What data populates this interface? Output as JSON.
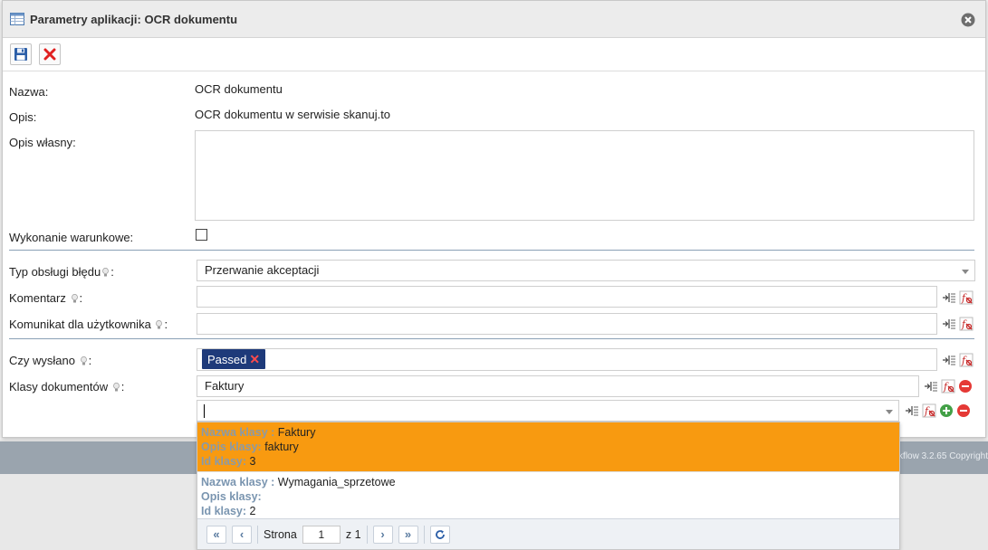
{
  "dialog": {
    "title": "Parametry aplikacji: OCR dokumentu"
  },
  "background": {
    "footer_text": "kflow 3.2.65 Copyright"
  },
  "form": {
    "name_label": "Nazwa:",
    "name_value": "OCR dokumentu",
    "desc_label": "Opis:",
    "desc_value": "OCR dokumentu w serwisie skanuj.to",
    "own_desc_label": "Opis własny:",
    "own_desc_value": "",
    "conditional_label": "Wykonanie warunkowe:",
    "conditional_checked": false,
    "error_type_label": "Typ obsługi błędu",
    "error_type_value": "Przerwanie akceptacji",
    "comment_label": "Komentarz",
    "comment_value": "",
    "user_message_label": "Komunikat dla użytkownika",
    "user_message_value": "",
    "sent_label": "Czy wysłano",
    "sent_tag": "Passed",
    "doc_classes_label": "Klasy dokumentów",
    "doc_classes_value": "Faktury",
    "colon": ":"
  },
  "dropdown": {
    "options": [
      {
        "name_key": "Nazwa klasy :",
        "name": "Faktury",
        "desc_key": "Opis klasy:",
        "desc": "faktury",
        "id_key": "Id klasy:",
        "id": "3",
        "selected": true
      },
      {
        "name_key": "Nazwa klasy :",
        "name": "Wymagania_sprzetowe",
        "desc_key": "Opis klasy:",
        "desc": "",
        "id_key": "Id klasy:",
        "id": "2",
        "selected": false
      }
    ],
    "pager": {
      "page_label": "Strona",
      "page_value": "1",
      "of_label": "z 1"
    }
  },
  "colors": {
    "selected_option": "#f89a10",
    "tag_bg": "#1e3a7a",
    "rule": "#8aa0b6"
  }
}
